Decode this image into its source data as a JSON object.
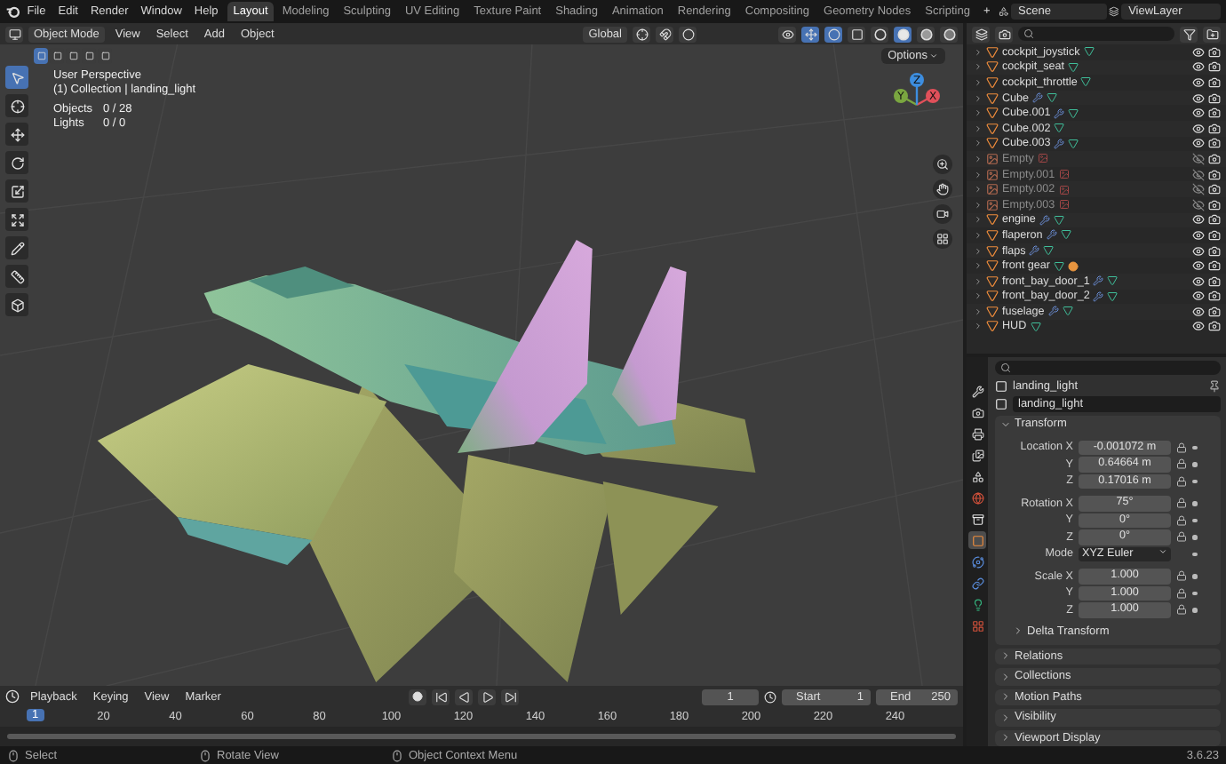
{
  "menu": [
    "File",
    "Edit",
    "Render",
    "Window",
    "Help"
  ],
  "workspaces": [
    {
      "label": "Layout",
      "selected": true
    },
    {
      "label": "Modeling",
      "selected": false
    },
    {
      "label": "Sculpting",
      "selected": false
    },
    {
      "label": "UV Editing",
      "selected": false
    },
    {
      "label": "Texture Paint",
      "selected": false
    },
    {
      "label": "Shading",
      "selected": false
    },
    {
      "label": "Animation",
      "selected": false
    },
    {
      "label": "Rendering",
      "selected": false
    },
    {
      "label": "Compositing",
      "selected": false
    },
    {
      "label": "Geometry Nodes",
      "selected": false
    },
    {
      "label": "Scripting",
      "selected": false
    }
  ],
  "add_workspace": "+",
  "scene": "Scene",
  "view_layer": "ViewLayer",
  "viewport": {
    "mode": "Object Mode",
    "menus": [
      "View",
      "Select",
      "Add",
      "Object"
    ],
    "orientation": "Global",
    "shading": [
      {
        "kind": "wireframe",
        "selected": false
      },
      {
        "kind": "solid",
        "selected": true
      },
      {
        "kind": "material",
        "selected": false
      },
      {
        "kind": "rendered",
        "selected": false
      }
    ],
    "options": "Options",
    "perspective": "User Perspective",
    "collection": "(1) Collection | landing_light",
    "stats": [
      {
        "label": "Objects",
        "value": "0 / 28"
      },
      {
        "label": "Lights",
        "value": "0 / 0"
      }
    ],
    "tools": [
      {
        "kind": "select",
        "selected": true
      },
      {
        "kind": "cursor",
        "selected": false
      },
      {
        "kind": "move",
        "selected": false
      },
      {
        "kind": "rotate",
        "selected": false
      },
      {
        "kind": "scale",
        "selected": false
      },
      {
        "kind": "transform",
        "selected": false
      },
      {
        "kind": "annotate",
        "selected": false
      },
      {
        "kind": "measure",
        "selected": false
      },
      {
        "kind": "add_cube",
        "selected": false
      }
    ],
    "gizmo_axes": [
      "X",
      "Y",
      "Z"
    ]
  },
  "outliner": {
    "rows": [
      {
        "name": "cockpit_joystick",
        "kind": "mesh",
        "modifier": false,
        "material": false,
        "visible": true
      },
      {
        "name": "cockpit_seat",
        "kind": "mesh",
        "modifier": false,
        "material": false,
        "visible": true
      },
      {
        "name": "cockpit_throttle",
        "kind": "mesh",
        "modifier": false,
        "material": false,
        "visible": true
      },
      {
        "name": "Cube",
        "kind": "mesh",
        "modifier": true,
        "material": false,
        "visible": true
      },
      {
        "name": "Cube.001",
        "kind": "mesh",
        "modifier": true,
        "material": false,
        "visible": true
      },
      {
        "name": "Cube.002",
        "kind": "mesh",
        "modifier": false,
        "material": false,
        "visible": true
      },
      {
        "name": "Cube.003",
        "kind": "mesh",
        "modifier": true,
        "material": false,
        "visible": true
      },
      {
        "name": "Empty",
        "kind": "empty",
        "modifier": false,
        "material": false,
        "visible": false
      },
      {
        "name": "Empty.001",
        "kind": "empty",
        "modifier": false,
        "material": false,
        "visible": false
      },
      {
        "name": "Empty.002",
        "kind": "empty",
        "modifier": false,
        "material": false,
        "visible": false
      },
      {
        "name": "Empty.003",
        "kind": "empty",
        "modifier": false,
        "material": false,
        "visible": false
      },
      {
        "name": "engine",
        "kind": "mesh",
        "modifier": true,
        "material": false,
        "visible": true
      },
      {
        "name": "flaperon",
        "kind": "mesh",
        "modifier": true,
        "material": false,
        "visible": true
      },
      {
        "name": "flaps",
        "kind": "mesh",
        "modifier": true,
        "material": false,
        "visible": true
      },
      {
        "name": "front gear",
        "kind": "mesh",
        "modifier": false,
        "material": true,
        "visible": true
      },
      {
        "name": "front_bay_door_1",
        "kind": "mesh",
        "modifier": true,
        "material": false,
        "visible": true
      },
      {
        "name": "front_bay_door_2",
        "kind": "mesh",
        "modifier": true,
        "material": false,
        "visible": true
      },
      {
        "name": "fuselage",
        "kind": "mesh",
        "modifier": true,
        "material": false,
        "visible": true
      },
      {
        "name": "HUD",
        "kind": "mesh",
        "modifier": false,
        "material": false,
        "visible": true
      }
    ]
  },
  "properties": {
    "tabs": [
      {
        "kind": "tool",
        "selected": false
      },
      {
        "kind": "render",
        "selected": false
      },
      {
        "kind": "output",
        "selected": false
      },
      {
        "kind": "view_layer",
        "selected": false
      },
      {
        "kind": "scene",
        "selected": false
      },
      {
        "kind": "world",
        "selected": false
      },
      {
        "kind": "collection",
        "selected": false
      },
      {
        "kind": "object",
        "selected": true
      },
      {
        "kind": "physics",
        "selected": false
      },
      {
        "kind": "constraints",
        "selected": false
      },
      {
        "kind": "data",
        "selected": false
      },
      {
        "kind": "texture",
        "selected": false
      }
    ],
    "object": "landing_light",
    "data_name": "landing_light",
    "transform": {
      "title": "Transform",
      "expanded": true,
      "groups": [
        {
          "rows": [
            {
              "label": "Location X",
              "value": "-0.001072 m",
              "kind": "number"
            },
            {
              "label": "Y",
              "value": "0.64664 m",
              "kind": "number"
            },
            {
              "label": "Z",
              "value": "0.17016 m",
              "kind": "number"
            }
          ]
        },
        {
          "rows": [
            {
              "label": "Rotation X",
              "value": "75°",
              "kind": "number"
            },
            {
              "label": "Y",
              "value": "0°",
              "kind": "number"
            },
            {
              "label": "Z",
              "value": "0°",
              "kind": "number"
            },
            {
              "label": "Mode",
              "value": "XYZ Euler",
              "kind": "dropdown"
            }
          ]
        },
        {
          "rows": [
            {
              "label": "Scale X",
              "value": "1.000",
              "kind": "number"
            },
            {
              "label": "Y",
              "value": "1.000",
              "kind": "number"
            },
            {
              "label": "Z",
              "value": "1.000",
              "kind": "number"
            }
          ]
        }
      ],
      "subpanel": {
        "title": "Delta Transform",
        "expanded": false
      }
    },
    "panels": [
      {
        "title": "Relations",
        "expanded": false
      },
      {
        "title": "Collections",
        "expanded": false
      },
      {
        "title": "Motion Paths",
        "expanded": false
      },
      {
        "title": "Visibility",
        "expanded": false
      },
      {
        "title": "Viewport Display",
        "expanded": false
      }
    ]
  },
  "timeline": {
    "menus": [
      "Playback",
      "Keying",
      "View",
      "Marker"
    ],
    "current_frame": "1",
    "start_label": "Start",
    "start": "1",
    "end_label": "End",
    "end": "250",
    "playhead": "1",
    "ruler": [
      "20",
      "40",
      "60",
      "80",
      "100",
      "120",
      "140",
      "160",
      "180",
      "200",
      "220",
      "240"
    ]
  },
  "status_bar": {
    "hints": [
      "Select",
      "Rotate View",
      "Object Context Menu"
    ],
    "version": "3.6.23"
  }
}
